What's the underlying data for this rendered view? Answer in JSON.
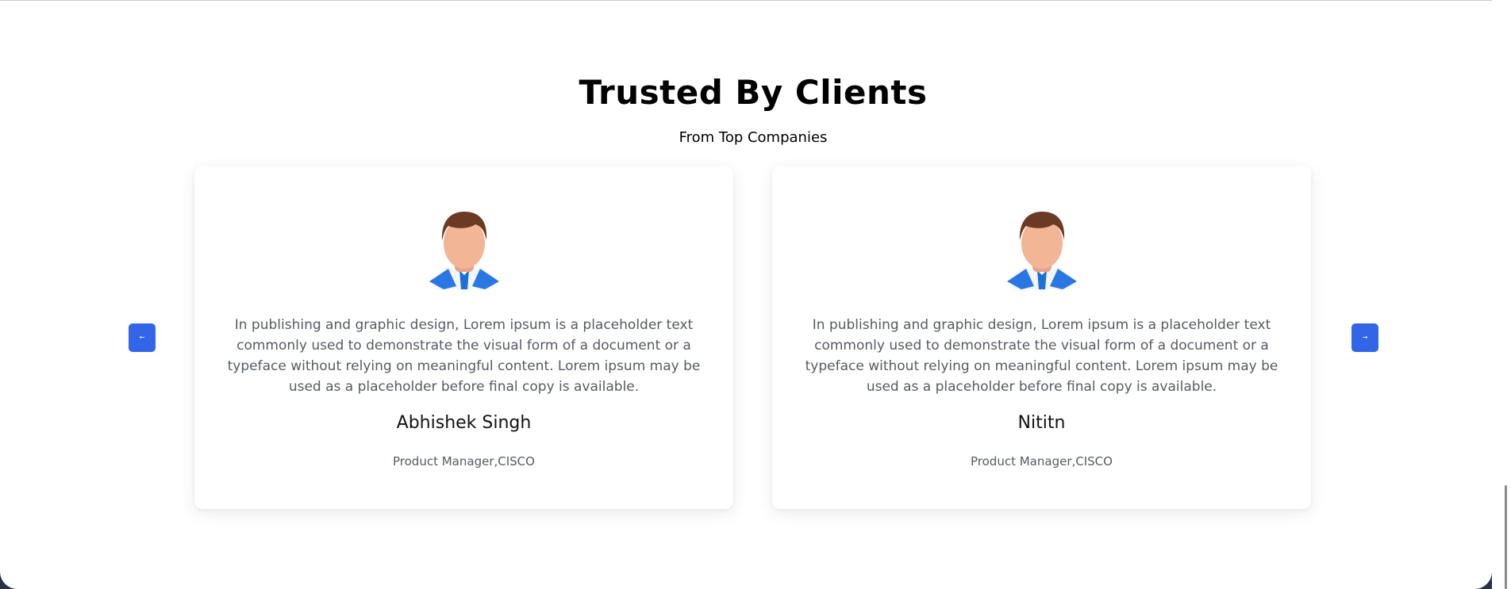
{
  "section": {
    "title": "Trusted By Clients",
    "subtitle": "From Top Companies"
  },
  "carousel": {
    "prev_label": "←",
    "next_label": "→"
  },
  "testimonials": [
    {
      "quote": "In publishing and graphic design, Lorem ipsum is a placeholder text commonly used to demonstrate the visual form of a document or a typeface without relying on meaningful content. Lorem ipsum may be used as a placeholder before final copy is available.",
      "name": "Abhishek Singh",
      "role": "Product Manager,CISCO",
      "avatar_icon": "businessman-avatar-icon"
    },
    {
      "quote": "In publishing and graphic design, Lorem ipsum is a placeholder text commonly used to demonstrate the visual form of a document or a typeface without relying on meaningful content. Lorem ipsum may be used as a placeholder before final copy is available.",
      "name": "Nititn",
      "role": "Product Manager,CISCO",
      "avatar_icon": "businessman-avatar-icon"
    }
  ],
  "colors": {
    "accent": "#3366e6",
    "text_muted": "#555a64",
    "heading": "#000000"
  }
}
